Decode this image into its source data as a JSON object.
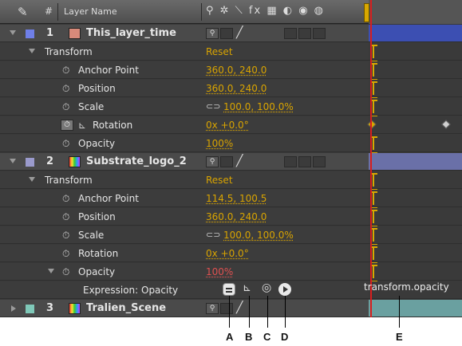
{
  "header": {
    "num_label": "#",
    "layer_name_label": "Layer Name",
    "switch_icons": "⚲ ✲ ⟍ fx ▦ ◐ ◉ ◍"
  },
  "layers": [
    {
      "index": "1",
      "name": "This_layer_time",
      "label_color": "#6f7fe8",
      "thumb_color": "#d88a7a",
      "transform_label": "Transform",
      "reset_label": "Reset",
      "props": [
        {
          "name": "Anchor Point",
          "value": "360.0, 240.0"
        },
        {
          "name": "Position",
          "value": "360.0, 240.0"
        },
        {
          "name": "Scale",
          "value": "100.0, 100.0%",
          "link": true
        },
        {
          "name": "Rotation",
          "value": "0x +0.0°",
          "keyed": true
        },
        {
          "name": "Opacity",
          "value": "100%"
        }
      ]
    },
    {
      "index": "2",
      "name": "Substrate_logo_2",
      "label_color": "#9a9acc",
      "transform_label": "Transform",
      "reset_label": "Reset",
      "props": [
        {
          "name": "Anchor Point",
          "value": "114.5, 100.5"
        },
        {
          "name": "Position",
          "value": "360.0, 240.0"
        },
        {
          "name": "Scale",
          "value": "100.0, 100.0%",
          "link": true
        },
        {
          "name": "Rotation",
          "value": "0x +0.0°"
        },
        {
          "name": "Opacity",
          "value": "100%",
          "red": true
        }
      ],
      "expression_label": "Expression: Opacity",
      "expression_text": "transform.opacity"
    },
    {
      "index": "3",
      "name": "Tralien_Scene",
      "label_color": "#7fc8b8"
    }
  ],
  "callouts": [
    "A",
    "B",
    "C",
    "D",
    "E"
  ],
  "colors": {
    "value": "#d9a400",
    "value_red": "#e05050",
    "playhead": "#d81e1e",
    "bar_layer1": "#3c4fb2",
    "bar_layer2": "#6a70a8",
    "bar_layer3": "#6aa0a0"
  }
}
